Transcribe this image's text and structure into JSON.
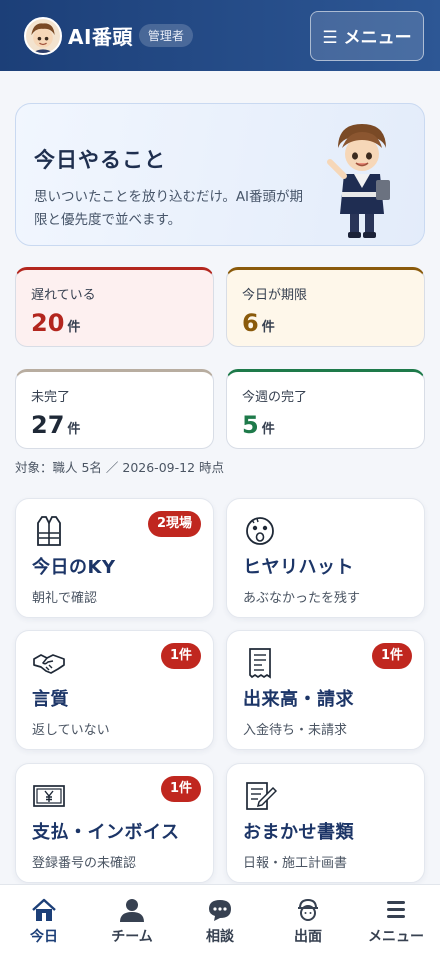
{
  "header": {
    "app_title": "AI番頭",
    "role_badge": "管理者",
    "menu_label": "☰ メニュー"
  },
  "hero": {
    "title": "今日やること",
    "description": "思いついたことを放り込むだけ。AI番頭が期限と優先度で並べます。"
  },
  "stats": [
    {
      "label": "遅れている",
      "value": "20",
      "unit": "件",
      "color": "#b3261e"
    },
    {
      "label": "今日が期限",
      "value": "6",
      "unit": "件",
      "color": "#8a5a0b"
    },
    {
      "label": "未完了",
      "value": "27",
      "unit": "件",
      "color": "#1f2937"
    },
    {
      "label": "今週の完了",
      "value": "5",
      "unit": "件",
      "color": "#1e7a4a"
    }
  ],
  "scope_note": "対象：職人 5名 ／ 2026-09-12 時点",
  "cards": [
    {
      "title": "今日のKY",
      "subtitle": "朝礼で確認",
      "badge": "2現場",
      "icon": "vest-icon"
    },
    {
      "title": "ヒヤリハット",
      "subtitle": "あぶなかったを残す",
      "badge": "",
      "icon": "scared-face-icon"
    },
    {
      "title": "言質",
      "subtitle": "返していない",
      "badge": "1件",
      "icon": "handshake-icon"
    },
    {
      "title": "出来高・請求",
      "subtitle": "入金待ち・未請求",
      "badge": "1件",
      "icon": "receipt-icon"
    },
    {
      "title": "支払・インボイス",
      "subtitle": "登録番号の未確認",
      "badge": "1件",
      "icon": "yen-bill-icon"
    },
    {
      "title": "おまかせ書類",
      "subtitle": "日報・施工計画書",
      "badge": "",
      "icon": "document-pen-icon"
    }
  ],
  "nav": [
    {
      "label": "今日",
      "icon": "home-icon",
      "active": true
    },
    {
      "label": "チーム",
      "icon": "team-icon",
      "active": false
    },
    {
      "label": "相談",
      "icon": "chat-icon",
      "active": false
    },
    {
      "label": "出面",
      "icon": "worker-helmet-icon",
      "active": false
    },
    {
      "label": "メニュー",
      "icon": "hamburger-icon",
      "active": false
    }
  ],
  "colors": {
    "header": "#1c3f78",
    "badge": "#c0271f",
    "title_navy": "#1c3567"
  }
}
